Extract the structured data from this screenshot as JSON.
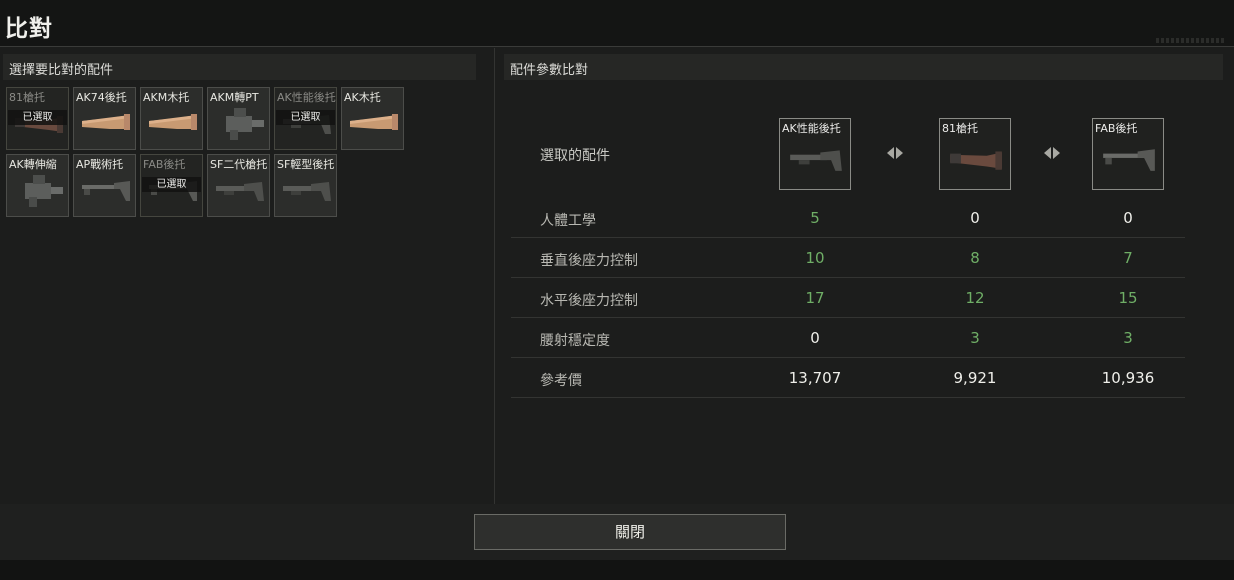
{
  "title": "比對",
  "left_panel": {
    "header": "選擇要比對的配件",
    "items": [
      {
        "name": "81槍托",
        "selected": true,
        "badge": "已選取",
        "kind": "wood-dark"
      },
      {
        "name": "AK74後托",
        "selected": false,
        "badge": "",
        "kind": "wood"
      },
      {
        "name": "AKM木托",
        "selected": false,
        "badge": "",
        "kind": "wood"
      },
      {
        "name": "AKM轉PT",
        "selected": false,
        "badge": "",
        "kind": "adapter"
      },
      {
        "name": "AK性能後托",
        "selected": true,
        "badge": "已選取",
        "kind": "tactical"
      },
      {
        "name": "AK木托",
        "selected": false,
        "badge": "",
        "kind": "wood"
      },
      {
        "name": "AK轉伸縮",
        "selected": false,
        "badge": "",
        "kind": "adapter"
      },
      {
        "name": "AP戰術托",
        "selected": false,
        "badge": "",
        "kind": "folding"
      },
      {
        "name": "FAB後托",
        "selected": true,
        "badge": "已選取",
        "kind": "folding"
      },
      {
        "name": "SF二代槍托",
        "selected": false,
        "badge": "",
        "kind": "tactical"
      },
      {
        "name": "SF輕型後托",
        "selected": false,
        "badge": "",
        "kind": "tactical"
      }
    ]
  },
  "right_panel": {
    "header": "配件參數比對",
    "selected_label": "選取的配件",
    "columns": [
      {
        "name": "AK性能後托",
        "kind": "tactical"
      },
      {
        "name": "81槍托",
        "kind": "wood-dark"
      },
      {
        "name": "FAB後托",
        "kind": "folding"
      }
    ],
    "rows": [
      {
        "label": "人體工學",
        "values": [
          "5",
          "0",
          "0"
        ],
        "highlight": [
          true,
          false,
          false
        ]
      },
      {
        "label": "垂直後座力控制",
        "values": [
          "10",
          "8",
          "7"
        ],
        "highlight": [
          true,
          true,
          true
        ]
      },
      {
        "label": "水平後座力控制",
        "values": [
          "17",
          "12",
          "15"
        ],
        "highlight": [
          true,
          true,
          true
        ]
      },
      {
        "label": "腰射穩定度",
        "values": [
          "0",
          "3",
          "3"
        ],
        "highlight": [
          false,
          true,
          true
        ]
      },
      {
        "label": "參考價",
        "values": [
          "13,707",
          "9,921",
          "10,936"
        ],
        "highlight": [
          false,
          false,
          false
        ]
      }
    ]
  },
  "footer": {
    "close_label": "關閉"
  },
  "colors": {
    "good": "#6fae66",
    "neutral": "#efefea",
    "background": "#1c1d1c"
  }
}
